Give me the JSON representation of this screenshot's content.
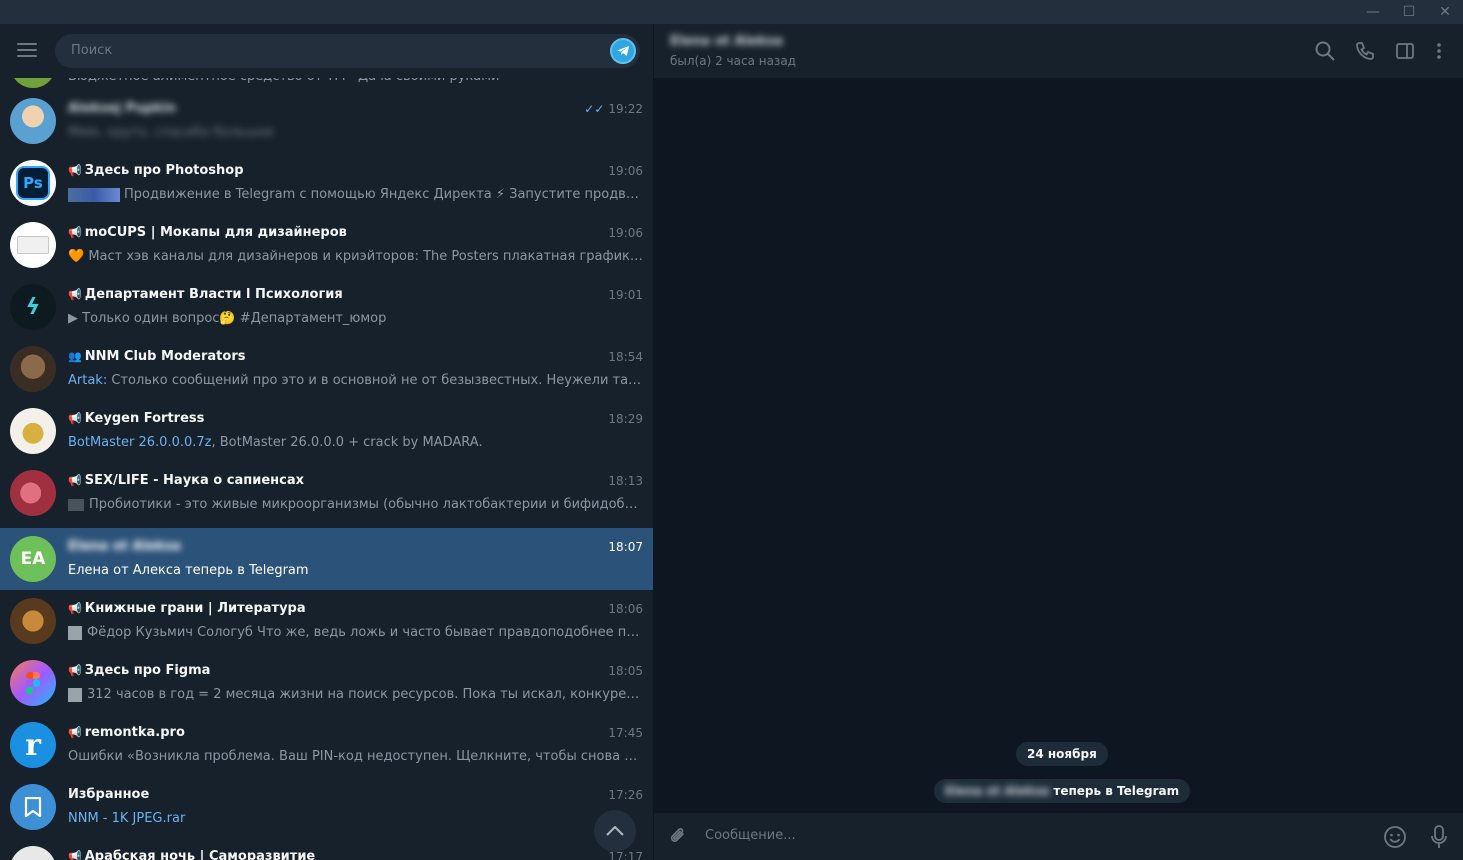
{
  "search": {
    "placeholder": "Поиск"
  },
  "chats": [
    {
      "name": "",
      "time": "",
      "preview": "Бюджетное алиментное средство от ТМ · Дача своими руками",
      "avatar": "partial-green"
    },
    {
      "name": "Aleksej Pupkin",
      "time": "19:22",
      "preview": "Ммм, круто, спасибо большое",
      "read": true,
      "blurred": true,
      "avatar": "photo-portrait"
    },
    {
      "name": "Здесь про Photoshop",
      "time": "19:06",
      "preview": "Продвижение в Telegram с помощью Яндекс Директа ⚡ Запустите продвижение...",
      "channel": true,
      "avatar_text": "Ps",
      "avatar_color": "#1f6ac2"
    },
    {
      "name": "moCUPS | Мокапы для дизайнеров",
      "time": "19:06",
      "preview": "🧡 Маст хэв каналы для дизайнеров и криэйторов:  The Posters плакатная графика и конк...",
      "channel": true,
      "avatar": "white-card"
    },
    {
      "name": "Департамент Власти l Психология",
      "time": "19:01",
      "preview": "▶ Только один вопрос🤔  #Департамент_юмор",
      "channel": true,
      "avatar": "dark-logo"
    },
    {
      "name": "NNM Club Moderators",
      "time": "18:54",
      "sender": "Artak:",
      "preview": " Столько сообщений про это и в основной не от безызвестных. Неужели так важно с...",
      "group": true,
      "avatar": "warrior-photo"
    },
    {
      "name": "Keygen Fortress",
      "time": "18:29",
      "sender": "BotMaster 26.0.0.0.7z",
      "preview": ", BotMaster 26.0.0.0 + crack by MADARA.",
      "channel": true,
      "avatar": "lock-photo"
    },
    {
      "name": "SEX/LIFE - Наука о сапиенсах",
      "time": "18:13",
      "preview": "Пробиотики - это живые микроорганизмы (обычно лактобактерии и бифидобактерии...",
      "channel": true,
      "avatar": "red-photo"
    },
    {
      "name": "Elena ot Aleksa",
      "time": "18:07",
      "preview": "Елена от Алекса теперь в Telegram",
      "selected": true,
      "blurred": true,
      "avatar_text": "EA",
      "avatar_color": "#6ec05a"
    },
    {
      "name": "Книжные грани | Литература",
      "time": "18:06",
      "preview": "Фёдор Кузьмич Сологуб  Что же, ведь ложь и часто бывает правдоподобнее правды. П...",
      "channel": true,
      "avatar": "book-photo"
    },
    {
      "name": "Здесь про Figma",
      "time": "18:05",
      "preview": "312 часов в год = 2 месяца жизни на поиск ресурсов.  Пока ты искал, конкуренты вырос...",
      "channel": true,
      "avatar": "figma-logo"
    },
    {
      "name": "remontka.pro",
      "time": "17:45",
      "preview": "Ошибки «Возникла проблема. Ваш PIN-код недоступен. Щелкните, чтобы снова настроит...",
      "channel": true,
      "avatar_text": "r",
      "avatar_color": "#1b8fe0"
    },
    {
      "name": "Избранное",
      "time": "17:26",
      "sender": "NNM - 1K JPEG.rar",
      "preview": "",
      "avatar": "bookmark-icon",
      "avatar_color": "#3d8fd6"
    },
    {
      "name": "Арабская ночь | Саморазвитие",
      "time": "17:17",
      "preview": "",
      "channel": true,
      "avatar": "partial"
    }
  ],
  "chat": {
    "title": "Elena ot Aleksa",
    "status": "был(а) 2 часа назад",
    "date_pill": "24 ноября",
    "system_name": "Elena ot Aleksa",
    "system_text": " теперь в Telegram",
    "composer_placeholder": "Сообщение..."
  },
  "colors": {
    "accent": "#2b5278",
    "link": "#6ab2f2",
    "bg": "#17212b",
    "chat_bg": "#0e1621"
  }
}
